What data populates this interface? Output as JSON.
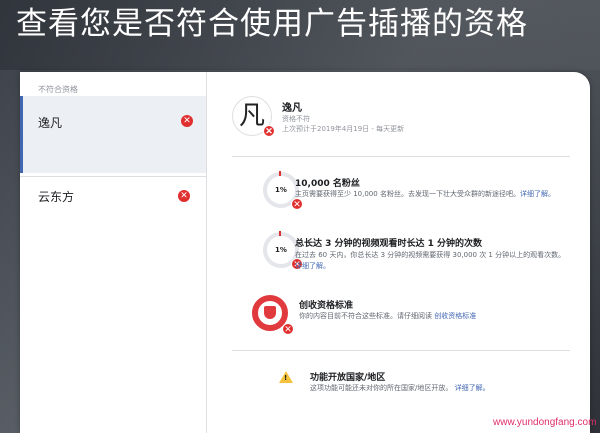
{
  "headline": "查看您是否符合使用广告插播的资格",
  "sidebar": {
    "section_label": "不符合资格",
    "items": [
      {
        "name": "逸凡",
        "selected": true
      },
      {
        "name": "云东方",
        "selected": false
      }
    ]
  },
  "profile": {
    "avatar_glyph": "凡",
    "name": "逸凡",
    "status": "资格不符",
    "last_checked": "上次预计于2019年4月19日 - 每天更新"
  },
  "requirements": [
    {
      "percent": "1%",
      "title": "10,000 名粉丝",
      "desc": "主页需要获得至少 10,000 名粉丝。去发现一下壮大受众群的新途径吧。",
      "link": "详细了解。"
    },
    {
      "percent": "1%",
      "title": "总长达 3 分钟的视频观看时长达 1 分钟的次数",
      "desc": "在过去 60 天内，你总长达 3 分钟的视频需要获得 30,000 次 1 分钟以上的观看次数。",
      "link": "详细了解。"
    },
    {
      "title": "创收资格标准",
      "desc": "你的内容目前不符合这些标准。请仔细阅读",
      "link": "创收资格标准"
    },
    {
      "title": "功能开放国家/地区",
      "desc": "这项功能可能还未对你的所在国家/地区开放。",
      "link": "详细了解。"
    }
  ],
  "watermark": "www.yundongfang.com",
  "colors": {
    "error": "#e02f2f",
    "link": "#4267b2",
    "warning": "#f5c33b",
    "selected_bar": "#4267b2"
  }
}
